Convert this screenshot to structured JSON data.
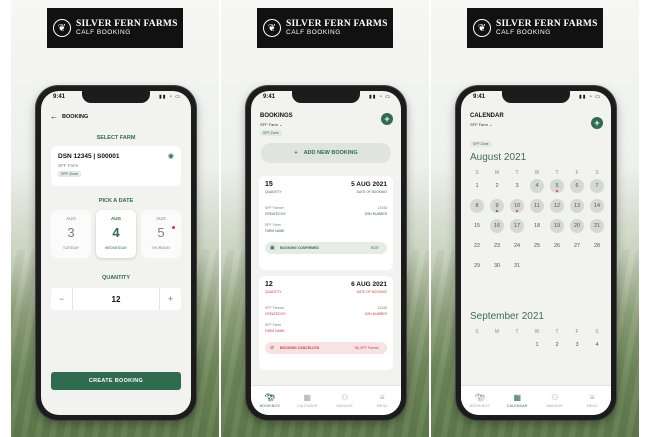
{
  "brand": {
    "name": "SILVER FERN FARMS",
    "sub": "CALF BOOKING"
  },
  "status_time": "9:41",
  "screen1": {
    "back_label": "BOOKING",
    "select_farm_label": "SELECT FARM",
    "farm_code": "DSN 12345 | S00001",
    "farm_name": "SFF Farm",
    "farm_tag": "SFF Zone",
    "pick_date_label": "PICK A DATE",
    "dates": [
      {
        "month": "AUG",
        "day": "3",
        "weekday": "TUESDAY"
      },
      {
        "month": "AUG",
        "day": "4",
        "weekday": "WEDNESDAY"
      },
      {
        "month": "AUG",
        "day": "5",
        "weekday": "THURSDAY"
      }
    ],
    "quantity_label": "QUANTITY",
    "quantity_value": "12",
    "minus": "−",
    "plus": "+",
    "create_label": "CREATE BOOKING"
  },
  "screen2": {
    "title": "BOOKINGS",
    "farm_select": "SFF Farm",
    "zone_tag": "SFF Zone",
    "add_label": "ADD NEW BOOKING",
    "bookings": [
      {
        "qty": "15",
        "qty_label": "QUANTITY",
        "date": "5 AUG 2021",
        "date_label": "DATE OF BOOKING",
        "farmer": "SFF Farmer",
        "created_by": "CREATED BY",
        "dsn": "12345",
        "dsn_label": "DSN NUMBER",
        "farm": "SFF Farm",
        "farm_label": "FARM NAME",
        "status": "BOOKING CONFIRMED",
        "action": "EDIT"
      },
      {
        "qty": "12",
        "qty_label": "QUANTITY",
        "date": "6 AUG 2021",
        "date_label": "DATE OF BOOKING",
        "farmer": "SFF Farmer",
        "created_by": "CREATED BY",
        "dsn": "12345",
        "dsn_label": "DSN NUMBER",
        "farm": "SFF Farm",
        "farm_label": "FARM NAME",
        "status": "BOOKING CANCELLED",
        "action": "By SFF Farmer"
      }
    ]
  },
  "screen3": {
    "title": "CALENDAR",
    "farm_select": "SFF Farm",
    "zone_tag": "SFF Zone",
    "month1": "August 2021",
    "month2": "September 2021",
    "weekdays": [
      "S",
      "M",
      "T",
      "W",
      "T",
      "F",
      "S"
    ],
    "aug_rows": [
      [
        "1",
        "2",
        "3",
        "4",
        "5",
        "6",
        "7"
      ],
      [
        "8",
        "9",
        "10",
        "11",
        "12",
        "13",
        "14"
      ],
      [
        "15",
        "16",
        "17",
        "18",
        "19",
        "20",
        "21"
      ],
      [
        "22",
        "23",
        "24",
        "25",
        "26",
        "27",
        "28"
      ],
      [
        "29",
        "30",
        "31",
        "",
        "",
        "",
        ""
      ]
    ],
    "sep_rows": [
      [
        "",
        "",
        "",
        "1",
        "2",
        "3",
        "4"
      ]
    ]
  },
  "tabs": [
    {
      "label": "BOOKINGS",
      "icon": "cow-icon"
    },
    {
      "label": "CALENDAR",
      "icon": "calendar-icon"
    },
    {
      "label": "MANAGE",
      "icon": "users-icon"
    },
    {
      "label": "MENU",
      "icon": "menu-icon"
    }
  ],
  "colors": {
    "accent": "#2f6b4f",
    "danger": "#d23b3b",
    "brand_bg": "#111111"
  }
}
